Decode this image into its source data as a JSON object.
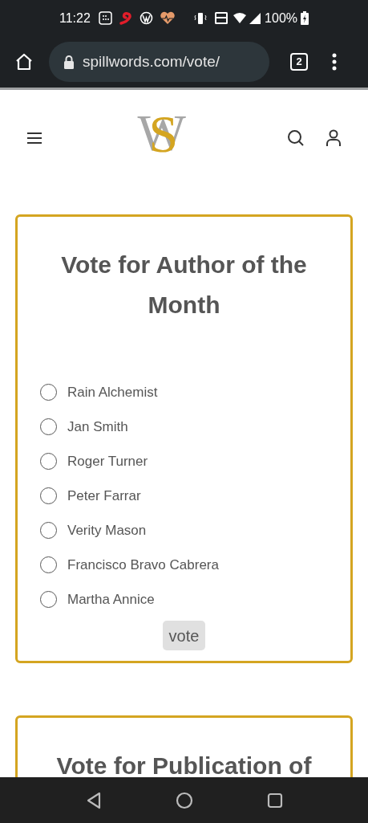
{
  "status_bar": {
    "time": "11:22",
    "battery": "100%"
  },
  "browser": {
    "url": "spillwords.com/vote/",
    "tab_count": "2"
  },
  "logo": {
    "primary": "S",
    "secondary": "W"
  },
  "cards": [
    {
      "title": "Vote for Author of the Month",
      "options": [
        {
          "label": "Rain Alchemist",
          "selected": false
        },
        {
          "label": "Jan Smith",
          "selected": false
        },
        {
          "label": "Roger Turner",
          "selected": false
        },
        {
          "label": "Peter Farrar",
          "selected": false
        },
        {
          "label": "Verity Mason",
          "selected": false
        },
        {
          "label": "Francisco Bravo Cabrera",
          "selected": false
        },
        {
          "label": "Martha Annice",
          "selected": false
        }
      ],
      "button": "vote"
    },
    {
      "title": "Vote for Publication of"
    }
  ]
}
